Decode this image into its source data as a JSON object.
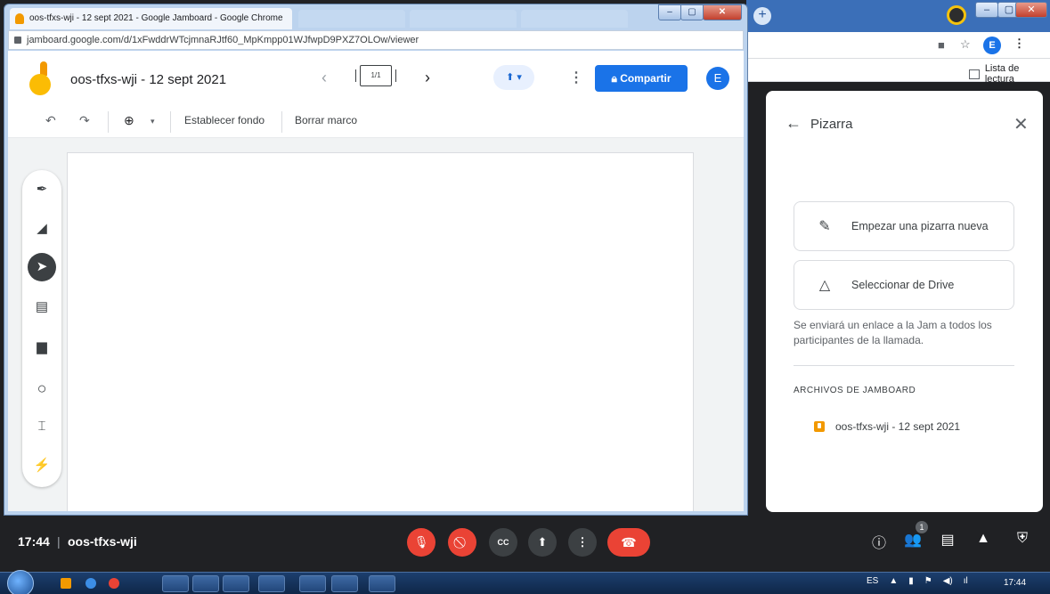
{
  "jamboard_window": {
    "tab_title": "oos-tfxs-wji - 12 sept 2021 - Google Jamboard - Google Chrome",
    "url": "jamboard.google.com/d/1xFwddrWTcjmnaRJtf60_MpKmpp01WJfwpD9PXZ7OLOw/viewer",
    "doc_title": "oos-tfxs-wji - 12 sept 2021",
    "frame_indicator": "1/1",
    "share_label": "Compartir",
    "user_initial": "E",
    "toolbar": {
      "set_background": "Establecer fondo",
      "clear_frame": "Borrar marco"
    },
    "tools": [
      "pen-icon",
      "eraser-icon",
      "select-icon",
      "sticky-note-icon",
      "image-icon",
      "circle-icon",
      "text-box-icon",
      "laser-icon"
    ]
  },
  "browser_right": {
    "reading_list": "Lista de lectura",
    "user_initial": "E"
  },
  "panel": {
    "title": "Pizarra",
    "new_board": "Empezar una pizarra nueva",
    "from_drive": "Seleccionar de Drive",
    "note": "Se enviará un enlace a la Jam a todos los participantes de la llamada.",
    "section_label": "ARCHIVOS DE JAMBOARD",
    "file_name": "oos-tfxs-wji - 12 sept 2021"
  },
  "meet_bar": {
    "time": "17:44",
    "separator": "|",
    "meeting_code": "oos-tfxs-wji",
    "participants_badge": "1"
  },
  "taskbar": {
    "language": "ES",
    "clock": "17:44"
  },
  "colors": {
    "accent": "#1a73e8",
    "danger": "#ea4335",
    "jam_orange": "#f29900",
    "meet_bg": "#202124"
  }
}
